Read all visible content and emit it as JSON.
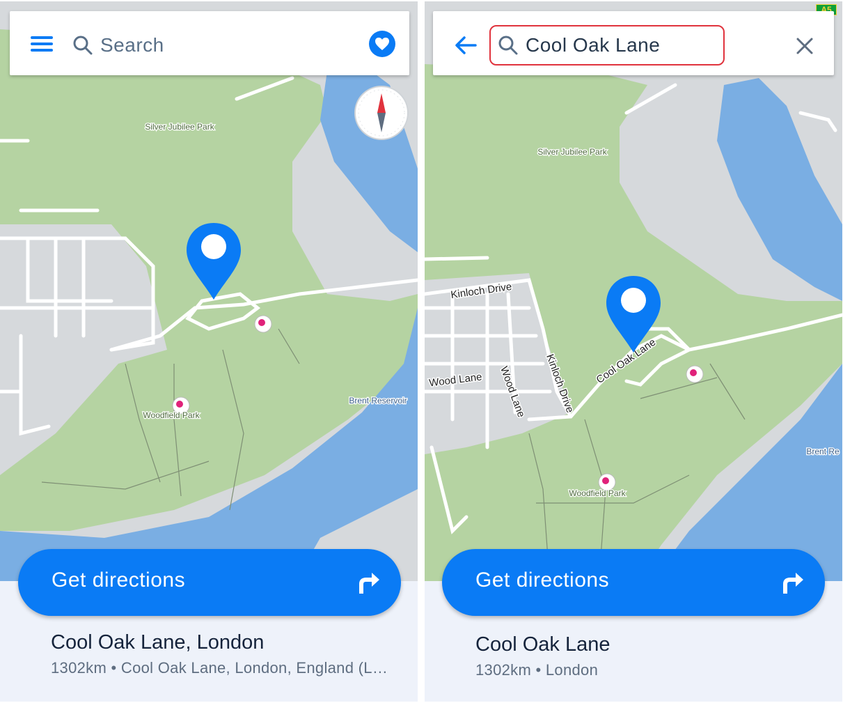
{
  "left_screen": {
    "search": {
      "placeholder": "Search",
      "icon": "search-icon"
    },
    "menu_icon": "menu-icon",
    "favorites_icon": "heart-icon",
    "compass_icon": "compass-icon",
    "map_labels": {
      "park_1": "Silver Jubilee Park",
      "park_2": "Woodfield Park",
      "reservoir": "Brent Reservoir"
    },
    "directions_button": {
      "label": "Get directions",
      "icon": "turn-right-icon"
    },
    "place": {
      "title": "Cool Oak Lane, London",
      "subtitle": "1302km • Cool Oak Lane, London, England (L…"
    }
  },
  "right_screen": {
    "search": {
      "value": "Cool Oak Lane",
      "icon": "search-icon"
    },
    "back_icon": "arrow-left-icon",
    "clear_icon": "close-icon",
    "road_shield": "A5",
    "map_labels": {
      "park_1": "Silver Jubilee Park",
      "park_2": "Woodfield Park",
      "reservoir": "Brent Re",
      "kinloch_drive_1": "Kinloch Drive",
      "kinloch_drive_2": "Kinloch Drive",
      "wood_lane_1": "Wood Lane",
      "wood_lane_2": "Wood Lane",
      "cool_oak_lane": "Cool Oak Lane"
    },
    "directions_button": {
      "label": "Get directions",
      "icon": "turn-right-icon"
    },
    "place": {
      "title": "Cool Oak Lane",
      "subtitle": "1302km • London"
    }
  },
  "colors": {
    "accent": "#0a7bf5",
    "park": "#b5d3a2",
    "water": "#7aaee3",
    "land": "#d6d9dc",
    "road": "#ffffff",
    "search_highlight": "#e0333d",
    "sheet_background": "#eef2fa"
  }
}
